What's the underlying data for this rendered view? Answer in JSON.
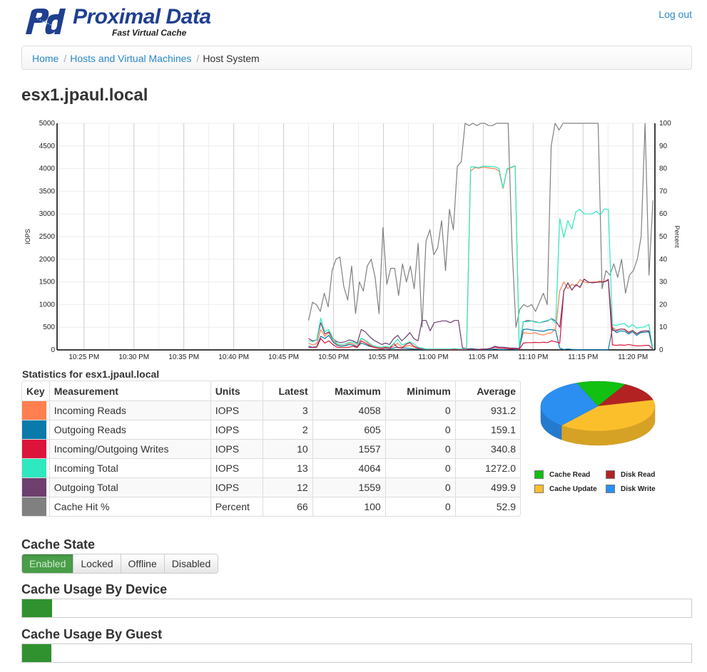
{
  "header": {
    "brand_name": "Proximal Data",
    "brand_tagline": "Fast Virtual Cache",
    "logout_label": "Log out"
  },
  "breadcrumb": [
    {
      "label": "Home",
      "link": true
    },
    {
      "label": "Hosts and Virtual Machines",
      "link": true
    },
    {
      "label": "Host System",
      "link": false
    }
  ],
  "page_title": "esx1.jpaul.local",
  "colors": {
    "incoming_reads": "#ff7f4f",
    "outgoing_reads": "#0a7aaa",
    "writes": "#dc143c",
    "incoming_total": "#2ee8c0",
    "outgoing_total": "#6e3f6e",
    "cache_hit": "#808080",
    "brand": "#1f3f8f",
    "link": "#2a8ac8",
    "enabled": "#4a9e4a",
    "usage_fill": "#2f922f"
  },
  "chart_data": {
    "type": "line",
    "xlabel": "",
    "ylabel": "IOPS",
    "ylabel_right": "Percent",
    "ylim": [
      0,
      5000
    ],
    "ylim_right": [
      0,
      100
    ],
    "yticks": [
      "0",
      "500",
      "1000",
      "1500",
      "2000",
      "2500",
      "3000",
      "3500",
      "4000",
      "4500",
      "5000"
    ],
    "yticks_right": [
      "0",
      "10",
      "20",
      "30",
      "40",
      "50",
      "60",
      "70",
      "80",
      "90",
      "100"
    ],
    "xticks": [
      "10:25 PM",
      "10:30 PM",
      "10:35 PM",
      "10:40 PM",
      "10:45 PM",
      "10:50 PM",
      "10:55 PM",
      "11:00 PM",
      "11:05 PM",
      "11:10 PM",
      "11:15 PM",
      "11:20 PM"
    ],
    "xtick_minutes": [
      25,
      30,
      35,
      40,
      45,
      50,
      55,
      60,
      65,
      70,
      75,
      80
    ],
    "xlim_minutes": [
      22.3,
      82.2
    ],
    "grid": true,
    "x_start_minute": 47.5,
    "x_step_minutes": 0.5,
    "series": [
      {
        "name": "Incoming Reads",
        "axis": "left",
        "color_key": "incoming_reads",
        "values": [
          150,
          110,
          140,
          450,
          300,
          380,
          210,
          120,
          90,
          100,
          150,
          130,
          80,
          250,
          200,
          120,
          70,
          50,
          40,
          60,
          40,
          80,
          150,
          60,
          80,
          100,
          60,
          30,
          20,
          10,
          10,
          10,
          10,
          10,
          10,
          10,
          20,
          10,
          10,
          10,
          3950,
          4020,
          4010,
          4030,
          4020,
          4010,
          4000,
          3950,
          3560,
          3980,
          4020,
          4058,
          40,
          380,
          370,
          360,
          380,
          340,
          330,
          360,
          380,
          470,
          1300,
          1500,
          1350,
          1450,
          1400,
          1550,
          1500,
          1480,
          1500,
          1500,
          1520,
          1510,
          1540,
          500,
          440,
          460,
          460,
          400,
          430,
          350,
          410,
          420,
          420,
          3
        ]
      },
      {
        "name": "Outgoing Reads",
        "axis": "left",
        "color_key": "outgoing_reads",
        "values": [
          80,
          60,
          70,
          300,
          250,
          320,
          180,
          100,
          80,
          90,
          120,
          100,
          60,
          150,
          120,
          80,
          60,
          40,
          30,
          40,
          30,
          40,
          60,
          40,
          40,
          30,
          20,
          15,
          10,
          10,
          10,
          10,
          10,
          10,
          10,
          10,
          10,
          10,
          10,
          10,
          30,
          20,
          10,
          10,
          10,
          10,
          20,
          10,
          10,
          10,
          20,
          10,
          10,
          450,
          460,
          440,
          430,
          420,
          410,
          440,
          450,
          430,
          40,
          10,
          20,
          10,
          5,
          5,
          5,
          5,
          5,
          5,
          5,
          5,
          5,
          480,
          380,
          420,
          410,
          350,
          400,
          320,
          380,
          390,
          400,
          2
        ]
      },
      {
        "name": "Incoming/Outgoing Writes",
        "axis": "left",
        "color_key": "writes",
        "values": [
          60,
          50,
          60,
          250,
          150,
          200,
          120,
          60,
          50,
          50,
          60,
          80,
          50,
          200,
          150,
          100,
          60,
          40,
          30,
          50,
          30,
          140,
          50,
          40,
          120,
          160,
          80,
          40,
          20,
          15,
          10,
          10,
          10,
          10,
          10,
          10,
          10,
          10,
          10,
          10,
          10,
          10,
          10,
          10,
          20,
          30,
          60,
          40,
          40,
          30,
          20,
          30,
          10,
          150,
          160,
          160,
          165,
          160,
          170,
          160,
          200,
          180,
          150,
          1300,
          1480,
          1320,
          1440,
          1380,
          1560,
          1500,
          1480,
          1490,
          1500,
          1500,
          1557,
          110,
          100,
          110,
          100,
          120,
          100,
          90,
          90,
          100,
          100,
          10
        ]
      },
      {
        "name": "Incoming Total",
        "axis": "left",
        "color_key": "incoming_total",
        "values": [
          200,
          180,
          220,
          700,
          400,
          450,
          260,
          140,
          120,
          130,
          170,
          170,
          120,
          260,
          210,
          150,
          90,
          70,
          60,
          80,
          60,
          140,
          240,
          110,
          140,
          180,
          130,
          60,
          40,
          20,
          20,
          20,
          20,
          20,
          20,
          20,
          30,
          20,
          20,
          20,
          4040,
          4040,
          4020,
          4050,
          4050,
          4050,
          4040,
          4000,
          3580,
          4000,
          4030,
          4064,
          60,
          630,
          620,
          640,
          610,
          600,
          630,
          650,
          680,
          590,
          2900,
          2480,
          2850,
          2670,
          3050,
          3100,
          3000,
          3000,
          3000,
          3060,
          2980,
          3110,
          3100,
          560,
          540,
          570,
          580,
          500,
          560,
          480,
          500,
          510,
          560,
          13
        ]
      },
      {
        "name": "Outgoing Total",
        "axis": "left",
        "color_key": "outgoing_total",
        "values": [
          250,
          200,
          220,
          600,
          350,
          400,
          250,
          180,
          160,
          180,
          220,
          200,
          150,
          450,
          400,
          300,
          220,
          170,
          120,
          150,
          120,
          250,
          320,
          200,
          280,
          380,
          250,
          200,
          650,
          650,
          420,
          600,
          620,
          640,
          640,
          600,
          650,
          650,
          40,
          30,
          10,
          10,
          10,
          20,
          20,
          40,
          80,
          60,
          60,
          50,
          40,
          40,
          30,
          620,
          650,
          640,
          620,
          600,
          620,
          640,
          690,
          640,
          500,
          1300,
          1480,
          1320,
          1440,
          1380,
          1559,
          1500,
          1480,
          1490,
          1500,
          1500,
          1540,
          430,
          420,
          460,
          450,
          380,
          430,
          360,
          400,
          420,
          420,
          12
        ]
      },
      {
        "name": "Cache Hit %",
        "axis": "right",
        "color_key": "cache_hit",
        "values": [
          13,
          21,
          20,
          17,
          25,
          19,
          35,
          40,
          41,
          28,
          22,
          37,
          16,
          30,
          26,
          37,
          40,
          32,
          16,
          54,
          29,
          36,
          36,
          24,
          38,
          30,
          37,
          27,
          47,
          10,
          48,
          53,
          42,
          45,
          57,
          35,
          62,
          53,
          81,
          83,
          100,
          99,
          100,
          99,
          100,
          100,
          99,
          99,
          100,
          100,
          100,
          100,
          45,
          10,
          18,
          20,
          19,
          20,
          17,
          21,
          25,
          20,
          90,
          100,
          97,
          100,
          100,
          100,
          100,
          100,
          100,
          100,
          100,
          100,
          100,
          27,
          35,
          33,
          38,
          32,
          40,
          25,
          33,
          35,
          40,
          50,
          100,
          33,
          66
        ]
      }
    ]
  },
  "stats": {
    "title": "Statistics for esx1.jpaul.local",
    "headers": [
      "Key",
      "Measurement",
      "Units",
      "Latest",
      "Maximum",
      "Minimum",
      "Average"
    ],
    "rows": [
      {
        "color_key": "incoming_reads",
        "measurement": "Incoming Reads",
        "units": "IOPS",
        "latest": "3",
        "maximum": "4058",
        "minimum": "0",
        "average": "931.2"
      },
      {
        "color_key": "outgoing_reads",
        "measurement": "Outgoing Reads",
        "units": "IOPS",
        "latest": "2",
        "maximum": "605",
        "minimum": "0",
        "average": "159.1"
      },
      {
        "color_key": "writes",
        "measurement": "Incoming/Outgoing Writes",
        "units": "IOPS",
        "latest": "10",
        "maximum": "1557",
        "minimum": "0",
        "average": "340.8"
      },
      {
        "color_key": "incoming_total",
        "measurement": "Incoming Total",
        "units": "IOPS",
        "latest": "13",
        "maximum": "4064",
        "minimum": "0",
        "average": "1272.0"
      },
      {
        "color_key": "outgoing_total",
        "measurement": "Outgoing Total",
        "units": "IOPS",
        "latest": "12",
        "maximum": "1559",
        "minimum": "0",
        "average": "499.9"
      },
      {
        "color_key": "cache_hit",
        "measurement": "Cache Hit %",
        "units": "Percent",
        "latest": "66",
        "maximum": "100",
        "minimum": "0",
        "average": "52.9"
      }
    ]
  },
  "pie": {
    "type": "pie",
    "slices": [
      {
        "label": "Cache Read",
        "value": 14,
        "color": "#11c011"
      },
      {
        "label": "Disk Read",
        "value": 13,
        "color": "#b22222"
      },
      {
        "label": "Cache Update",
        "value": 40,
        "color": "#fcbf2c"
      },
      {
        "label": "Disk Write",
        "value": 33,
        "color": "#2a8ff0"
      }
    ],
    "legend": [
      {
        "label": "Cache Read",
        "color": "#11c011"
      },
      {
        "label": "Disk Read",
        "color": "#b22222"
      },
      {
        "label": "Cache Update",
        "color": "#fcbf2c"
      },
      {
        "label": "Disk Write",
        "color": "#2a8ff0"
      }
    ]
  },
  "cache_state": {
    "title": "Cache State",
    "options": [
      "Enabled",
      "Locked",
      "Offline",
      "Disabled"
    ],
    "selected": "Enabled"
  },
  "usage_device": {
    "title": "Cache Usage By Device",
    "fraction": 0.045
  },
  "usage_guest": {
    "title": "Cache Usage By Guest",
    "fraction": 0.044
  }
}
